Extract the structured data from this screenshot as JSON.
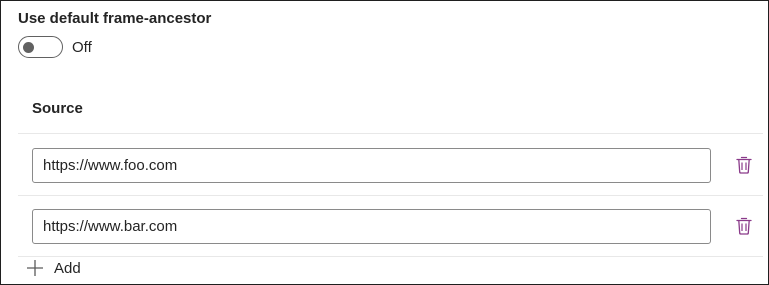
{
  "setting": {
    "title": "Use default frame-ancestor",
    "toggle": {
      "state_label": "Off",
      "on": false
    }
  },
  "table": {
    "column_header": "Source",
    "rows": [
      {
        "value": "https://www.foo.com",
        "delete_icon": "trash-icon"
      },
      {
        "value": "https://www.bar.com",
        "delete_icon": "trash-icon"
      }
    ]
  },
  "add": {
    "label": "Add",
    "icon": "plus-icon"
  },
  "colors": {
    "icon_accent": "#8a3a8a",
    "border": "#8a8a8a",
    "divider": "#e8e8e8"
  }
}
